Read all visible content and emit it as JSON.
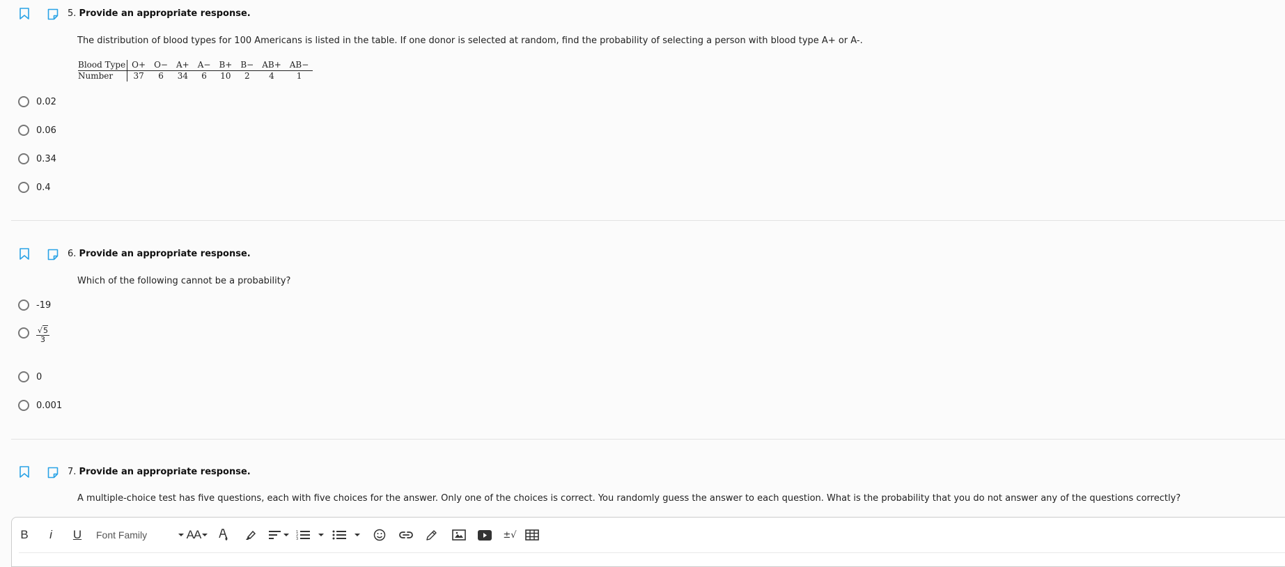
{
  "colors": {
    "accent": "#2aa3e6",
    "background": "#fbfbfb"
  },
  "questions": [
    {
      "number": "5.",
      "title": "Provide an appropriate response.",
      "prompt": "The distribution of blood types for 100 Americans is listed in the table. If one donor is selected at random, find the probability of selecting a person with blood type A+ or A-.",
      "table": {
        "row_headers": [
          "Blood Type",
          "Number"
        ],
        "columns": [
          "O+",
          "O−",
          "A+",
          "A−",
          "B+",
          "B−",
          "AB+",
          "AB−"
        ],
        "values": [
          "37",
          "6",
          "34",
          "6",
          "10",
          "2",
          "4",
          "1"
        ]
      },
      "choices": [
        "0.02",
        "0.06",
        "0.34",
        "0.4"
      ]
    },
    {
      "number": "6.",
      "title": "Provide an appropriate response.",
      "prompt": "Which of the following cannot be a probability?",
      "choices": [
        "-19",
        "√5 / 3",
        "0",
        "0.001"
      ],
      "fraction_choice": {
        "numerator_radicand": "5",
        "denominator": "3"
      }
    },
    {
      "number": "7.",
      "title": "Provide an appropriate response.",
      "prompt": "A multiple-choice test has five questions, each with five choices for the answer. Only one of the choices is correct. You randomly guess the answer to each question. What is the probability that you do not answer any of the questions correctly?"
    }
  ],
  "editor": {
    "bold_label": "B",
    "italic_label": "i",
    "underline_label": "U",
    "font_family_label": "Font Family",
    "font_size_label": "AA",
    "math_label": "±√",
    "icons": [
      "bold-icon",
      "italic-icon",
      "underline-icon",
      "font-family-select",
      "font-size-icon",
      "text-color-icon",
      "highlight-icon",
      "align-icon",
      "ordered-list-icon",
      "unordered-list-icon",
      "emoji-icon",
      "link-icon",
      "draw-icon",
      "image-icon",
      "video-icon",
      "math-icon",
      "table-icon"
    ]
  }
}
